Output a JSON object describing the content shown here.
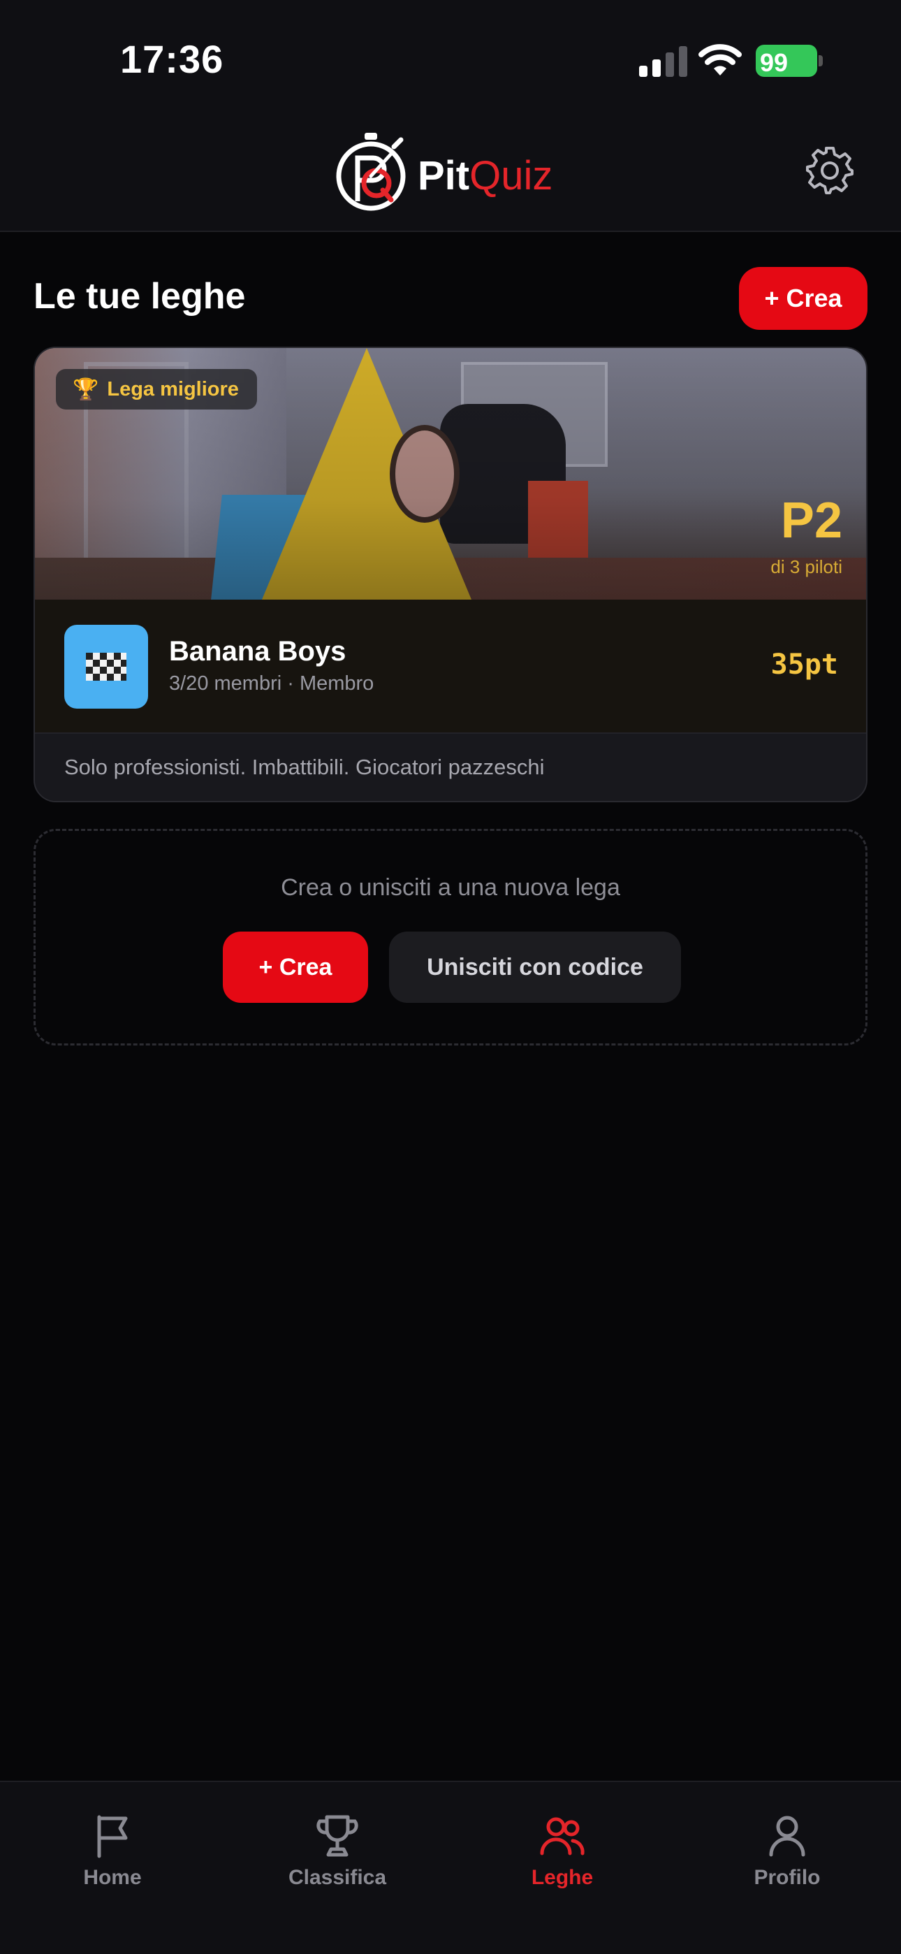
{
  "status_bar": {
    "time": "17:36",
    "battery": "99"
  },
  "header": {
    "logo_part1": "Pit",
    "logo_part2": "Quiz"
  },
  "section": {
    "title": "Le tue leghe",
    "create_label": "+ Crea"
  },
  "league_card": {
    "badge": "Lega migliore",
    "position": "P2",
    "position_sub": "di 3 piloti",
    "name": "Banana Boys",
    "meta": "3/20 membri · Membro",
    "points": "35pt",
    "description": "Solo professionisti. Imbattibili. Giocatori pazzeschi",
    "icon": "checkered-flag-icon"
  },
  "join_box": {
    "text": "Crea o unisciti a una nuova lega",
    "create_label": "+ Crea",
    "join_label": "Unisciti con codice"
  },
  "tabs": [
    {
      "label": "Home",
      "icon": "flag-icon",
      "active": false
    },
    {
      "label": "Classifica",
      "icon": "trophy-icon",
      "active": false
    },
    {
      "label": "Leghe",
      "icon": "users-icon",
      "active": true
    },
    {
      "label": "Profilo",
      "icon": "user-icon",
      "active": false
    }
  ],
  "colors": {
    "accent": "#e5252a",
    "primary_button": "#e50914",
    "gold": "#f5c542",
    "background": "#060608"
  }
}
